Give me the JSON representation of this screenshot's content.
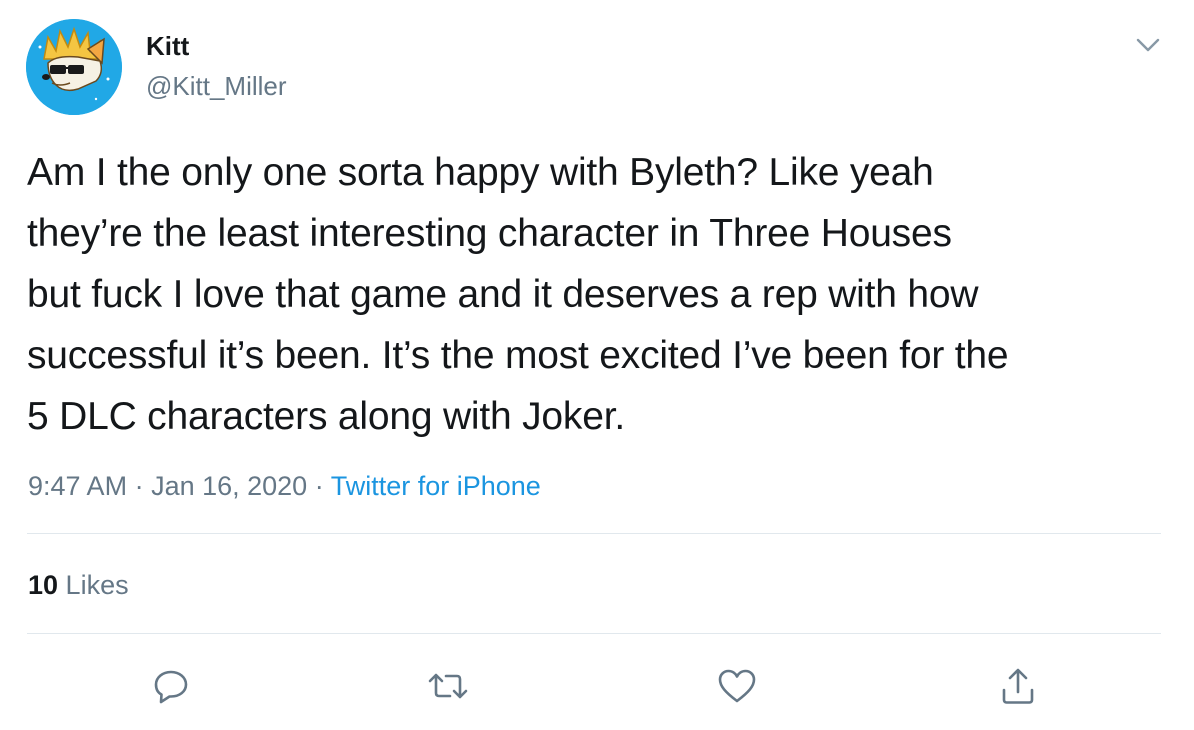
{
  "user": {
    "display_name": "Kitt",
    "handle": "@Kitt_Miller",
    "avatar_icon": "fox-avatar"
  },
  "tweet": {
    "text": "Am I the only one sorta happy with Byleth? Like yeah\nthey’re the least interesting character in Three Houses\nbut fuck I love that game and it deserves a rep with how\nsuccessful it’s been. It’s the most excited I’ve been for the\n5 DLC characters along with Joker.",
    "time": "9:47 AM",
    "separator": " · ",
    "date": "Jan 16, 2020",
    "source": "Twitter for iPhone"
  },
  "stats": {
    "likes_count": "10",
    "likes_label": " Likes"
  },
  "actions": {
    "reply_icon": "reply-icon",
    "retweet_icon": "retweet-icon",
    "like_icon": "heart-icon",
    "share_icon": "share-icon",
    "menu_icon": "chevron-down-icon"
  },
  "colors": {
    "link": "#1b95e0",
    "secondary_text": "#657786",
    "divider": "#e1e8ed",
    "avatar_bg": "#21a8e6"
  }
}
